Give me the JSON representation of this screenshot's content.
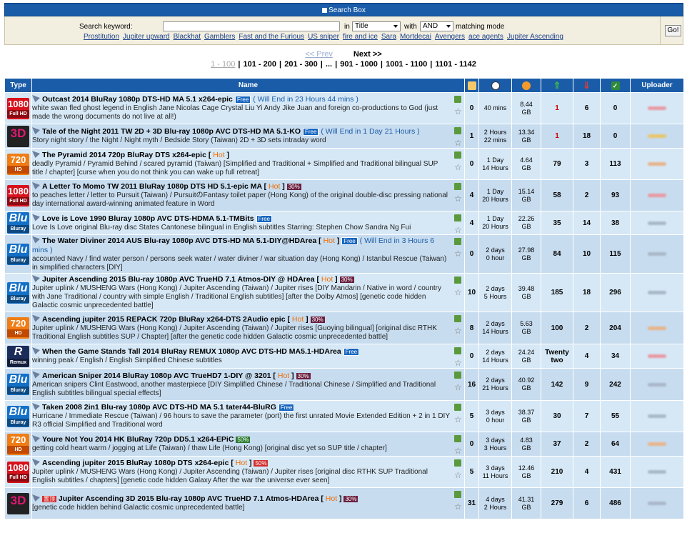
{
  "search": {
    "header": "Search Box",
    "keyword_label": "Search keyword:",
    "keyword_value": "",
    "in_label": "in",
    "field_select": "Title",
    "with_label": "with",
    "mode_select": "AND",
    "mode_label": "matching mode",
    "go_label": "Go!",
    "tags": [
      "Prostitution",
      "Jupiter upward",
      "Blackhat",
      "Gamblers",
      "Fast and the Furious",
      "US sniper",
      "fire and ice",
      "Sara",
      "Mortdecai",
      "Avengers",
      "ace agents",
      "Jupiter Ascending"
    ]
  },
  "pager": {
    "prev": "<< Prev",
    "next": "Next >>",
    "current": "1 - 100",
    "pages": [
      "101 - 200",
      "201 - 300",
      "...",
      "901 - 1000",
      "1001 - 1100",
      "1101 - 1142"
    ]
  },
  "columns": {
    "type": "Type",
    "name": "Name",
    "uploader": "Uploader"
  },
  "icons": {
    "comments": "comment-icon",
    "time": "clock-icon",
    "size": "size-icon",
    "seeders": "up-arrow-icon",
    "leechers": "down-arrow-icon",
    "completed": "check-icon"
  },
  "rows": [
    {
      "badge": {
        "big": "1080",
        "small": "Full HD",
        "kind": "1080"
      },
      "title": "Outcast 2014 BluRay 1080p DTS-HD MA 5.1 x264-epic",
      "free": "Free",
      "ends": "( Will End in 23 Hours 44 mins )",
      "hot": "",
      "pct": "",
      "subtitle": "white swan fled ghost legend in English Jane Nicolas Cage Crystal Liu Yi Andy Jike Juan and foreign co-productions to God (just made the wrong documents do not live at all!)",
      "comments": "0",
      "time": "40 mins",
      "size": "8.44\nGB",
      "seeders": "1",
      "leechers": "6",
      "completed": "0",
      "seed_red": true,
      "uploader_color": "pink"
    },
    {
      "badge": {
        "big": "3D",
        "small": "",
        "kind": "3d"
      },
      "title": "Tale of the Night 2011 TW 2D + 3D Blu-ray 1080p AVC DTS-HD MA 5.1-KO",
      "free": "Free",
      "ends": "( Will End in 1 Day 21 Hours )",
      "hot": "",
      "pct": "",
      "subtitle": "Story night story / the Night / Night myth / Bedside Story (Taiwan) 2D + 3D sets intraday word",
      "comments": "1",
      "time": "2 Hours\n22 mins",
      "size": "13.34\nGB",
      "seeders": "1",
      "leechers": "18",
      "completed": "0",
      "seed_red": true,
      "uploader_color": "gold"
    },
    {
      "badge": {
        "big": "720",
        "small": "HD",
        "kind": "720"
      },
      "title": "The Pyramid 2014 720p BluRay DTS x264-epic [",
      "free": "",
      "ends": "",
      "hot": "Hot",
      "pct": "",
      "close": " ]",
      "subtitle": "deadly Pyramid / Pyramid Behind / scared pyramid (Taiwan) [Simplified and Traditional + Simplified and Traditional bilingual SUP title / chapter] [curse when you do not think you can wake up full retreat]",
      "comments": "0",
      "time": "1 Day\n14 Hours",
      "size": "4.64\nGB",
      "seeders": "79",
      "leechers": "3",
      "completed": "113",
      "seed_red": false,
      "uploader_color": "peach"
    },
    {
      "badge": {
        "big": "1080",
        "small": "Full HD",
        "kind": "1080"
      },
      "title": "A Letter To Momo TW 2011 BluRay 1080p DTS HD 5.1-epic MA [",
      "free": "",
      "ends": "",
      "hot": "Hot",
      "pct": "30%",
      "close": "",
      "subtitle": "to peaches letter / letter to Pursuit (Taiwan) / PursuitのFantasy toilet paper (Hong Kong) of the original double-disc pressing national day international award-winning animated feature in Word",
      "comments": "4",
      "time": "1 Day\n20 Hours",
      "size": "15.14\nGB",
      "seeders": "58",
      "leechers": "2",
      "completed": "93",
      "seed_red": false,
      "uploader_color": "pink"
    },
    {
      "badge": {
        "big": "Blu",
        "small": "Bluray",
        "kind": "bluray"
      },
      "title": "Love is Love 1990 Bluray 1080p AVC DTS-HDMA 5.1-TMBits",
      "free": "Free",
      "ends": "",
      "hot": "",
      "pct": "",
      "subtitle": "Love Is Love original Blu-ray disc States Cantonese bilingual in English subtitles Starring: Stephen Chow Sandra Ng Fui",
      "comments": "4",
      "time": "1 Day\n20 Hours",
      "size": "22.26\nGB",
      "seeders": "35",
      "leechers": "14",
      "completed": "38",
      "seed_red": false,
      "uploader_color": ""
    },
    {
      "badge": {
        "big": "Blu",
        "small": "Bluray",
        "kind": "bluray"
      },
      "title": "The Water Diviner 2014 AUS Blu-ray 1080p AVC DTS-HD MA 5.1-DIY@HDArea [",
      "free": "Free",
      "ends": "( Will End in 3 Hours 6 mins )",
      "hot": "Hot",
      "pct": "",
      "close": " ]",
      "subtitle": "accounted Navy / find water person / persons seek water / water diviner / war situation day (Hong Kong) / Istanbul Rescue (Taiwan) in simplified characters [DIY]",
      "comments": "0",
      "time": "2 days\n0 hour",
      "size": "27.98\nGB",
      "seeders": "84",
      "leechers": "10",
      "completed": "115",
      "seed_red": false,
      "uploader_color": ""
    },
    {
      "badge": {
        "big": "Blu",
        "small": "Bluray",
        "kind": "bluray"
      },
      "title": "Jupiter Ascending 2015 Blu-ray 1080p AVC TrueHD 7.1 Atmos-DIY @ HDArea [",
      "free": "",
      "ends": "",
      "hot": "Hot",
      "pct": "30%",
      "close": "",
      "subtitle": "Jupiter uplink / MUSHENG Wars (Hong Kong) / Jupiter Ascending (Taiwan) / Jupiter rises [DIY Mandarin / Native in word / country with Jane Traditional / country with simple English / Traditional English subtitles] [after the Dolby Atmos] [genetic code hidden Galactic cosmic unprecedented battle]",
      "comments": "10",
      "time": "2 days\n5 Hours",
      "size": "39.48\nGB",
      "seeders": "185",
      "leechers": "18",
      "completed": "296",
      "seed_red": false,
      "uploader_color": ""
    },
    {
      "badge": {
        "big": "720",
        "small": "HD",
        "kind": "720"
      },
      "title": "Ascending jupiter 2015 REPACK 720p BluRay x264-DTS 2Audio epic [",
      "free": "",
      "ends": "",
      "hot": "Hot",
      "pct": "30%",
      "close": "",
      "subtitle": "Jupiter uplink / MUSHENG Wars (Hong Kong) / Jupiter Ascending (Taiwan) / Jupiter rises [Guoying bilingual] [original disc RTHK Traditional English subtitles SUP / Chapter] [after the genetic code hidden Galactic cosmic unprecedented battle]",
      "comments": "8",
      "time": "2 days\n14 Hours",
      "size": "5.63\nGB",
      "seeders": "100",
      "leechers": "2",
      "completed": "204",
      "seed_red": false,
      "uploader_color": "peach"
    },
    {
      "badge": {
        "big": "R",
        "small": "Remux",
        "kind": "remux"
      },
      "title": "When the Game Stands Tall 2014 BluRay REMUX 1080p AVC DTS-HD MA5.1-HDArea",
      "free": "Free",
      "ends": "",
      "hot": "",
      "pct": "",
      "subtitle": "winning peak / English / English Simplified Chinese subtitles",
      "comments": "0",
      "time": "2 days\n14 Hours",
      "size": "24.24\nGB",
      "seeders": "Twenty\ntwo",
      "leechers": "4",
      "completed": "34",
      "seed_red": false,
      "uploader_color": "pink"
    },
    {
      "badge": {
        "big": "Blu",
        "small": "Bluray",
        "kind": "bluray"
      },
      "title": "American Sniper 2014 BluRay 1080p AVC TrueHD7 1-DIY @ 3201 [",
      "free": "",
      "ends": "",
      "hot": "Hot",
      "pct": "30%",
      "close": "",
      "subtitle": "American snipers Clint Eastwood, another masterpiece [DIY Simplified Chinese / Traditional Chinese / Simplified and Traditional English subtitles bilingual special effects]",
      "comments": "16",
      "time": "2 days\n21 Hours",
      "size": "40.92\nGB",
      "seeders": "142",
      "leechers": "9",
      "completed": "242",
      "seed_red": false,
      "uploader_color": ""
    },
    {
      "badge": {
        "big": "Blu",
        "small": "Bluray",
        "kind": "bluray"
      },
      "title": "Taken 2008 2in1 Blu-ray 1080p AVC DTS-HD MA 5.1 tater44-BluRG",
      "free": "Free",
      "ends": "",
      "hot": "",
      "pct": "",
      "subtitle": "Hurricane / Immediate Rescue (Taiwan) / 96 hours to save the parameter (port) the first unrated Movie Extended Edition + 2 in 1 DIY R3 official Simplified and Traditional word",
      "comments": "5",
      "time": "3 days\n0 hour",
      "size": "38.37\nGB",
      "seeders": "30",
      "leechers": "7",
      "completed": "55",
      "seed_red": false,
      "uploader_color": ""
    },
    {
      "badge": {
        "big": "720",
        "small": "HD",
        "kind": "720"
      },
      "title": "Youre Not You 2014 HK BluRay 720p DD5.1 x264-EPiC",
      "free": "",
      "ends": "",
      "hot": "",
      "pct": "50%",
      "pct_style": "green",
      "subtitle": "getting cold heart warm / jogging at Life (Taiwan) / thaw Life (Hong Kong) [original disc yet so SUP title / chapter]",
      "comments": "0",
      "time": "3 days\n3 Hours",
      "size": "4.83\nGB",
      "seeders": "37",
      "leechers": "2",
      "completed": "64",
      "seed_red": false,
      "uploader_color": "peach"
    },
    {
      "badge": {
        "big": "1080",
        "small": "Full HD",
        "kind": "1080"
      },
      "title": "Ascending jupiter 2015 BluRay 1080p DTS x264-epic [",
      "free": "",
      "ends": "",
      "hot": "Hot",
      "pct": "50%",
      "pct_style": "red",
      "close": "",
      "subtitle": "Jupiter uplink / MUSHENG Wars (Hong Kong) / Jupiter Ascending (Taiwan) / Jupiter rises [original disc RTHK SUP Traditional English subtitles / chapters] [genetic code hidden Galaxy After the war the universe ever seen]",
      "comments": "5",
      "time": "3 days\n11 Hours",
      "size": "12.46\nGB",
      "seeders": "210",
      "leechers": "4",
      "completed": "431",
      "seed_red": false,
      "uploader_color": ""
    },
    {
      "badge": {
        "big": "3D",
        "small": "",
        "kind": "3d"
      },
      "title": "Jupiter Ascending 3D 2015 Blu-ray 1080p AVC TrueHD 7.1 Atmos-HDArea [",
      "free": "",
      "ends": "",
      "hot": "Hot",
      "pct": "30%",
      "close": "",
      "prefix": "置顶",
      "subtitle": "[genetic code hidden behind Galactic cosmic unprecedented battle]",
      "comments": "31",
      "time": "4 days\n2 Hours",
      "size": "41.31\nGB",
      "seeders": "279",
      "leechers": "6",
      "completed": "486",
      "seed_red": false,
      "uploader_color": ""
    }
  ]
}
